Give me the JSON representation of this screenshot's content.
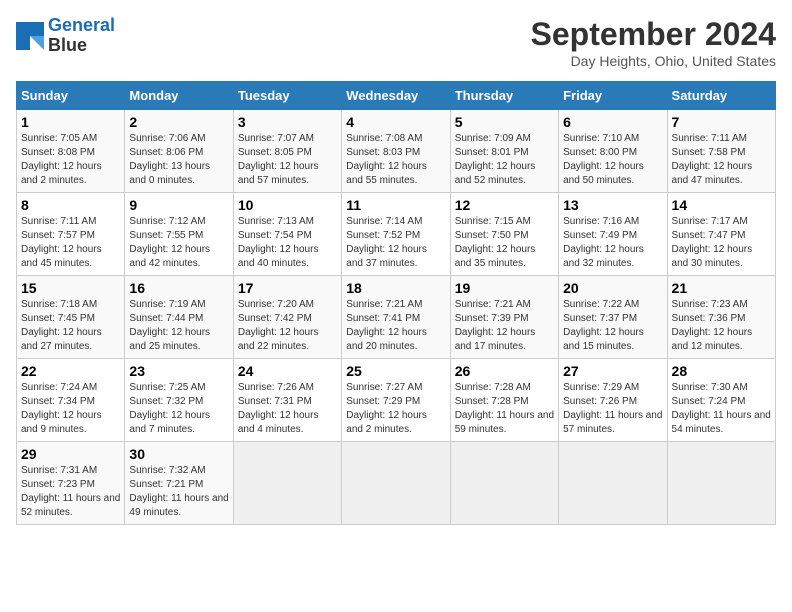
{
  "header": {
    "logo_line1": "General",
    "logo_line2": "Blue",
    "month": "September 2024",
    "location": "Day Heights, Ohio, United States"
  },
  "weekdays": [
    "Sunday",
    "Monday",
    "Tuesday",
    "Wednesday",
    "Thursday",
    "Friday",
    "Saturday"
  ],
  "weeks": [
    [
      {
        "day": "1",
        "sunrise": "Sunrise: 7:05 AM",
        "sunset": "Sunset: 8:08 PM",
        "daylight": "Daylight: 12 hours and 2 minutes."
      },
      {
        "day": "2",
        "sunrise": "Sunrise: 7:06 AM",
        "sunset": "Sunset: 8:06 PM",
        "daylight": "Daylight: 13 hours and 0 minutes."
      },
      {
        "day": "3",
        "sunrise": "Sunrise: 7:07 AM",
        "sunset": "Sunset: 8:05 PM",
        "daylight": "Daylight: 12 hours and 57 minutes."
      },
      {
        "day": "4",
        "sunrise": "Sunrise: 7:08 AM",
        "sunset": "Sunset: 8:03 PM",
        "daylight": "Daylight: 12 hours and 55 minutes."
      },
      {
        "day": "5",
        "sunrise": "Sunrise: 7:09 AM",
        "sunset": "Sunset: 8:01 PM",
        "daylight": "Daylight: 12 hours and 52 minutes."
      },
      {
        "day": "6",
        "sunrise": "Sunrise: 7:10 AM",
        "sunset": "Sunset: 8:00 PM",
        "daylight": "Daylight: 12 hours and 50 minutes."
      },
      {
        "day": "7",
        "sunrise": "Sunrise: 7:11 AM",
        "sunset": "Sunset: 7:58 PM",
        "daylight": "Daylight: 12 hours and 47 minutes."
      }
    ],
    [
      {
        "day": "8",
        "sunrise": "Sunrise: 7:11 AM",
        "sunset": "Sunset: 7:57 PM",
        "daylight": "Daylight: 12 hours and 45 minutes."
      },
      {
        "day": "9",
        "sunrise": "Sunrise: 7:12 AM",
        "sunset": "Sunset: 7:55 PM",
        "daylight": "Daylight: 12 hours and 42 minutes."
      },
      {
        "day": "10",
        "sunrise": "Sunrise: 7:13 AM",
        "sunset": "Sunset: 7:54 PM",
        "daylight": "Daylight: 12 hours and 40 minutes."
      },
      {
        "day": "11",
        "sunrise": "Sunrise: 7:14 AM",
        "sunset": "Sunset: 7:52 PM",
        "daylight": "Daylight: 12 hours and 37 minutes."
      },
      {
        "day": "12",
        "sunrise": "Sunrise: 7:15 AM",
        "sunset": "Sunset: 7:50 PM",
        "daylight": "Daylight: 12 hours and 35 minutes."
      },
      {
        "day": "13",
        "sunrise": "Sunrise: 7:16 AM",
        "sunset": "Sunset: 7:49 PM",
        "daylight": "Daylight: 12 hours and 32 minutes."
      },
      {
        "day": "14",
        "sunrise": "Sunrise: 7:17 AM",
        "sunset": "Sunset: 7:47 PM",
        "daylight": "Daylight: 12 hours and 30 minutes."
      }
    ],
    [
      {
        "day": "15",
        "sunrise": "Sunrise: 7:18 AM",
        "sunset": "Sunset: 7:45 PM",
        "daylight": "Daylight: 12 hours and 27 minutes."
      },
      {
        "day": "16",
        "sunrise": "Sunrise: 7:19 AM",
        "sunset": "Sunset: 7:44 PM",
        "daylight": "Daylight: 12 hours and 25 minutes."
      },
      {
        "day": "17",
        "sunrise": "Sunrise: 7:20 AM",
        "sunset": "Sunset: 7:42 PM",
        "daylight": "Daylight: 12 hours and 22 minutes."
      },
      {
        "day": "18",
        "sunrise": "Sunrise: 7:21 AM",
        "sunset": "Sunset: 7:41 PM",
        "daylight": "Daylight: 12 hours and 20 minutes."
      },
      {
        "day": "19",
        "sunrise": "Sunrise: 7:21 AM",
        "sunset": "Sunset: 7:39 PM",
        "daylight": "Daylight: 12 hours and 17 minutes."
      },
      {
        "day": "20",
        "sunrise": "Sunrise: 7:22 AM",
        "sunset": "Sunset: 7:37 PM",
        "daylight": "Daylight: 12 hours and 15 minutes."
      },
      {
        "day": "21",
        "sunrise": "Sunrise: 7:23 AM",
        "sunset": "Sunset: 7:36 PM",
        "daylight": "Daylight: 12 hours and 12 minutes."
      }
    ],
    [
      {
        "day": "22",
        "sunrise": "Sunrise: 7:24 AM",
        "sunset": "Sunset: 7:34 PM",
        "daylight": "Daylight: 12 hours and 9 minutes."
      },
      {
        "day": "23",
        "sunrise": "Sunrise: 7:25 AM",
        "sunset": "Sunset: 7:32 PM",
        "daylight": "Daylight: 12 hours and 7 minutes."
      },
      {
        "day": "24",
        "sunrise": "Sunrise: 7:26 AM",
        "sunset": "Sunset: 7:31 PM",
        "daylight": "Daylight: 12 hours and 4 minutes."
      },
      {
        "day": "25",
        "sunrise": "Sunrise: 7:27 AM",
        "sunset": "Sunset: 7:29 PM",
        "daylight": "Daylight: 12 hours and 2 minutes."
      },
      {
        "day": "26",
        "sunrise": "Sunrise: 7:28 AM",
        "sunset": "Sunset: 7:28 PM",
        "daylight": "Daylight: 11 hours and 59 minutes."
      },
      {
        "day": "27",
        "sunrise": "Sunrise: 7:29 AM",
        "sunset": "Sunset: 7:26 PM",
        "daylight": "Daylight: 11 hours and 57 minutes."
      },
      {
        "day": "28",
        "sunrise": "Sunrise: 7:30 AM",
        "sunset": "Sunset: 7:24 PM",
        "daylight": "Daylight: 11 hours and 54 minutes."
      }
    ],
    [
      {
        "day": "29",
        "sunrise": "Sunrise: 7:31 AM",
        "sunset": "Sunset: 7:23 PM",
        "daylight": "Daylight: 11 hours and 52 minutes."
      },
      {
        "day": "30",
        "sunrise": "Sunrise: 7:32 AM",
        "sunset": "Sunset: 7:21 PM",
        "daylight": "Daylight: 11 hours and 49 minutes."
      },
      null,
      null,
      null,
      null,
      null
    ]
  ]
}
